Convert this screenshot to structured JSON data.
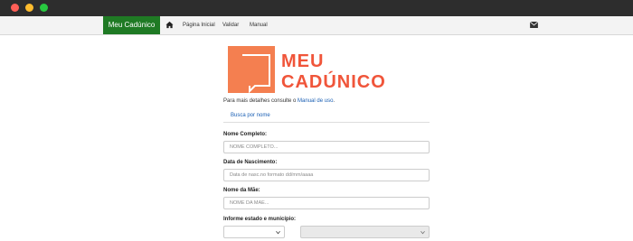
{
  "navbar": {
    "brand": "Meu Cadúnico",
    "links": [
      "Página Inicial",
      "Validar",
      "Manual"
    ]
  },
  "logo": {
    "line1": "MEU",
    "line2": "CADÚNICO"
  },
  "help": {
    "prefix": "Para mais detalhes consulte o ",
    "link": "Manual de uso",
    "suffix": "."
  },
  "tab": {
    "label": "Busca por nome"
  },
  "form": {
    "name_label": "Nome Completo:",
    "name_placeholder": "NOME COMPLETO...",
    "birth_label": "Data de Nascimento:",
    "birth_placeholder": "Data de nasc.no formato dd/mm/aaaa",
    "mother_label": "Nome da Mãe:",
    "mother_placeholder": "NOME DA MÃE...",
    "location_label": "Informe estado e município:"
  },
  "colors": {
    "brand_green": "#1f7a24",
    "logo_orange": "#f47f50",
    "logo_text": "#f0553a",
    "link_blue": "#1a5fb4"
  },
  "icons": {
    "home": "home-icon",
    "envelope": "envelope-icon"
  }
}
